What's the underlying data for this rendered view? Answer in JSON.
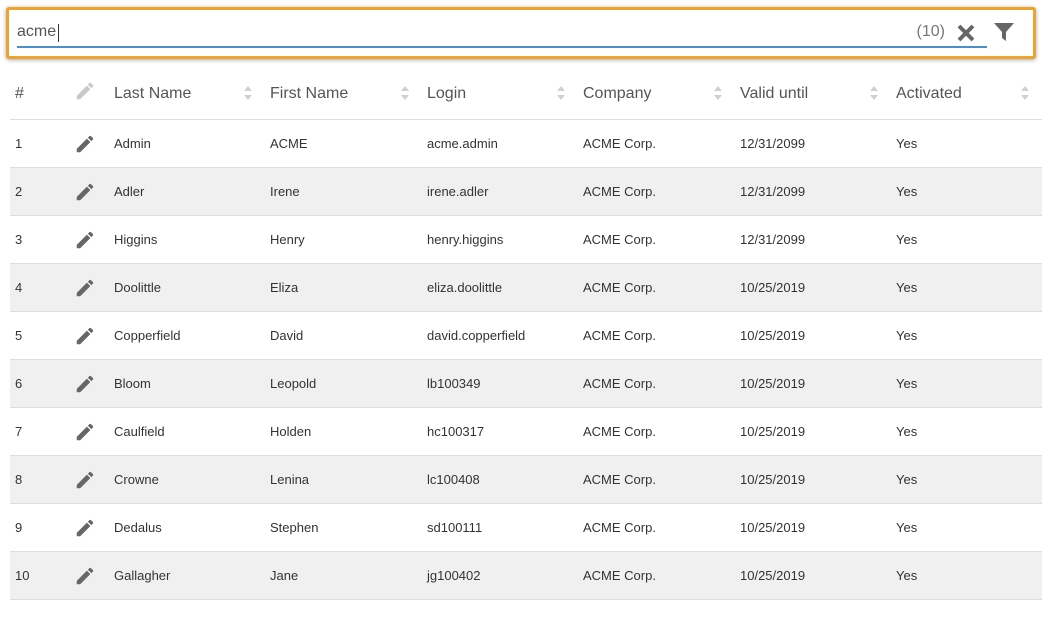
{
  "search": {
    "value": "acme",
    "count": "(10)"
  },
  "columns": {
    "num": "#",
    "last_name": "Last Name",
    "first_name": "First Name",
    "login": "Login",
    "company": "Company",
    "valid_until": "Valid until",
    "activated": "Activated"
  },
  "colors": {
    "accent": "#f0a22e",
    "underline": "#4a90c8",
    "row_alt": "#f0f0f0"
  },
  "rows": [
    {
      "num": "1",
      "last_name": "Admin",
      "first_name": "ACME",
      "login": "acme.admin",
      "company": "ACME Corp.",
      "valid_until": "12/31/2099",
      "activated": "Yes"
    },
    {
      "num": "2",
      "last_name": "Adler",
      "first_name": "Irene",
      "login": "irene.adler",
      "company": "ACME Corp.",
      "valid_until": "12/31/2099",
      "activated": "Yes"
    },
    {
      "num": "3",
      "last_name": "Higgins",
      "first_name": "Henry",
      "login": "henry.higgins",
      "company": "ACME Corp.",
      "valid_until": "12/31/2099",
      "activated": "Yes"
    },
    {
      "num": "4",
      "last_name": "Doolittle",
      "first_name": "Eliza",
      "login": "eliza.doolittle",
      "company": "ACME Corp.",
      "valid_until": "10/25/2019",
      "activated": "Yes"
    },
    {
      "num": "5",
      "last_name": "Copperfield",
      "first_name": "David",
      "login": "david.copperfield",
      "company": "ACME Corp.",
      "valid_until": "10/25/2019",
      "activated": "Yes"
    },
    {
      "num": "6",
      "last_name": "Bloom",
      "first_name": "Leopold",
      "login": "lb100349",
      "company": "ACME Corp.",
      "valid_until": "10/25/2019",
      "activated": "Yes"
    },
    {
      "num": "7",
      "last_name": "Caulfield",
      "first_name": "Holden",
      "login": "hc100317",
      "company": "ACME Corp.",
      "valid_until": "10/25/2019",
      "activated": "Yes"
    },
    {
      "num": "8",
      "last_name": "Crowne",
      "first_name": "Lenina",
      "login": "lc100408",
      "company": "ACME Corp.",
      "valid_until": "10/25/2019",
      "activated": "Yes"
    },
    {
      "num": "9",
      "last_name": "Dedalus",
      "first_name": "Stephen",
      "login": "sd100111",
      "company": "ACME Corp.",
      "valid_until": "10/25/2019",
      "activated": "Yes"
    },
    {
      "num": "10",
      "last_name": "Gallagher",
      "first_name": "Jane",
      "login": "jg100402",
      "company": "ACME Corp.",
      "valid_until": "10/25/2019",
      "activated": "Yes"
    }
  ]
}
